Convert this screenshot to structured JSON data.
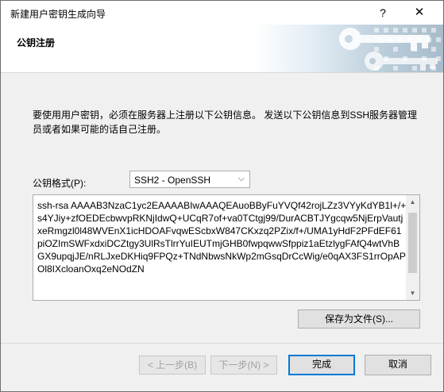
{
  "window": {
    "title": "新建用户密钥生成向导",
    "help_glyph": "?",
    "close_glyph": "✕"
  },
  "header": {
    "title": "公钥注册"
  },
  "content": {
    "description": "要使用用户密钥，必须在服务器上注册以下公钥信息。 发送以下公钥信息到SSH服务器管理员或者如果可能的话自己注册。",
    "format_label": "公钥格式(P):",
    "format_value": "SSH2 - OpenSSH",
    "format_chevron": "⌵",
    "key_text": "ssh-rsa AAAAB3NzaC1yc2EAAAABIwAAAQEAuoBByFuYVQf42rojLZz3VYyKdYB1l+/+s4YJiy+zfOEDEcbwvpRKNjIdwQ+UCqR7of+va0TCtgj99/DurACBTJYgcqw5NjErpVautjxeRmgzl0l48WVEnX1icHDOAFvqwEScbxW847CKxzq2PZix/f+/UMA1yHdF2PFdEF61piOZImSWFxdxiDCZtgy3UlRsTlrrYuIEUTmjGHB0fwpqwwSfppiz1aEtzlygFAfQ4wtVhBGX9upqjJE/nRLJxeDKHiq9FPQz+TNdNbwsNkWp2mGsqDrCcWig/e0qAX3FS1rrOpAPOl8IXcloanOxq2eNOdZN",
    "save_button": "保存为文件(S)..."
  },
  "footer": {
    "back_button": "< 上一步(B)",
    "next_button": "下一步(N) >",
    "finish_button": "完成",
    "cancel_button": "取消"
  },
  "colors": {
    "accent": "#0078d7",
    "banner": "#b9ccd9"
  }
}
